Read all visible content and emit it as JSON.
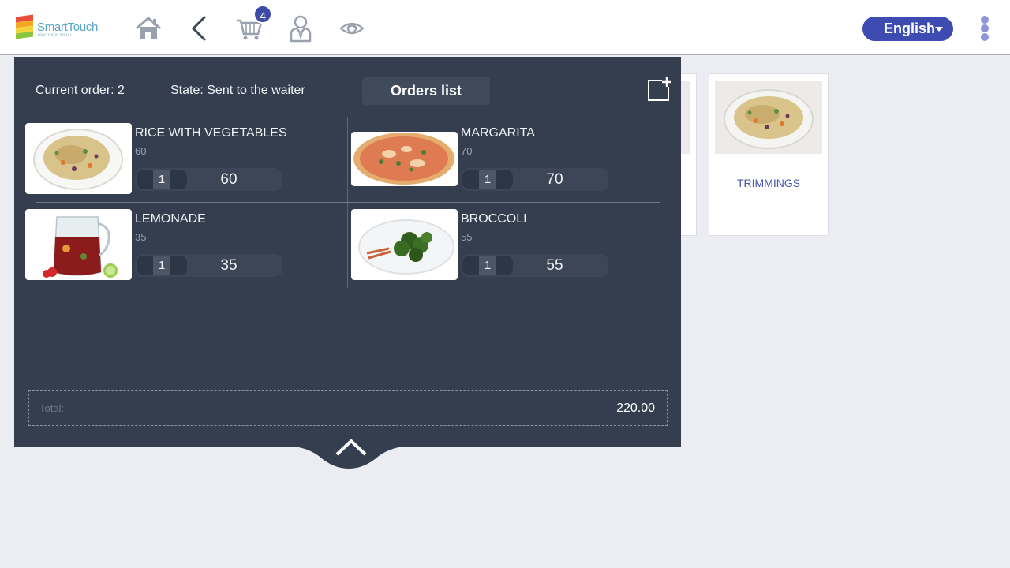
{
  "header": {
    "logo_name": "SmartTouch",
    "logo_subtitle": "electronic menu",
    "cart_count": "4",
    "language": "English",
    "icons": [
      "home-icon",
      "back-icon",
      "cart-icon",
      "waiter-icon",
      "eye-icon",
      "more-vert-icon"
    ],
    "accent_color": "#3e4bb0"
  },
  "background": {
    "category_label": "TRIMMINGS"
  },
  "order": {
    "current_order": "Current order: 2",
    "state": "State: Sent to the waiter",
    "orders_list_label": "Orders list",
    "items": [
      {
        "name": "RICE WITH VEGETABLES",
        "price": "60",
        "qty": "1",
        "sum": "60"
      },
      {
        "name": "MARGARITA",
        "price": "70",
        "qty": "1",
        "sum": "70"
      },
      {
        "name": "LEMONADE",
        "price": "35",
        "qty": "1",
        "sum": "35"
      },
      {
        "name": "BROCCOLI",
        "price": "55",
        "qty": "1",
        "sum": "55"
      }
    ],
    "total_label": "Total:",
    "total_value": "220.00",
    "panel_color": "#343e4e"
  }
}
